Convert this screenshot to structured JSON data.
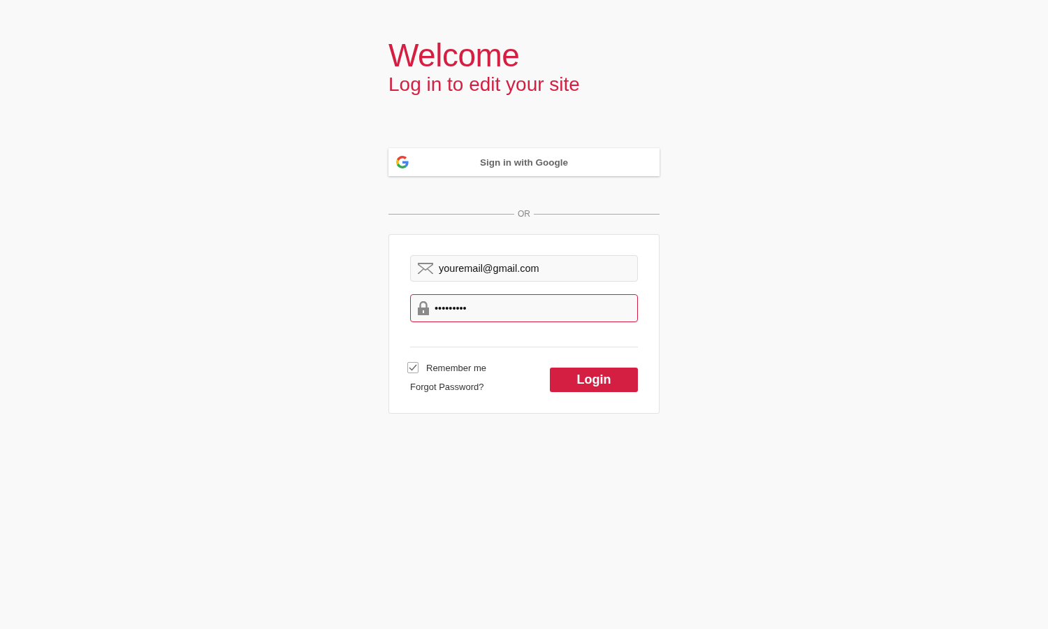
{
  "heading": {
    "title": "Welcome",
    "subtitle": "Log in to edit your site"
  },
  "google_button": {
    "label": "Sign in with Google"
  },
  "divider": {
    "label": "OR"
  },
  "form": {
    "fields": [
      {
        "kind": "email",
        "value": "youremail@gmail.com",
        "focused": false
      },
      {
        "kind": "password",
        "value": "•••••••••",
        "focused": true
      }
    ],
    "remember_me": {
      "label": "Remember me",
      "checked": true
    },
    "forgot_link": "Forgot Password?",
    "login_button": "Login"
  }
}
